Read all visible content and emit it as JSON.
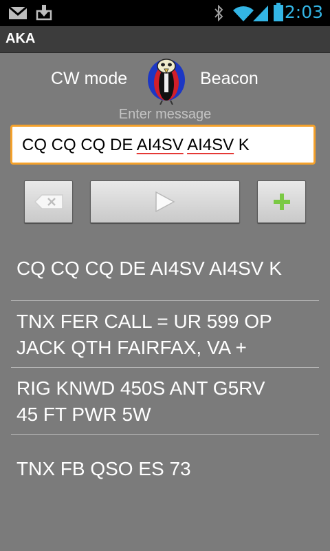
{
  "status_bar": {
    "time": "2:03",
    "icons": [
      "gmail-icon",
      "download-icon",
      "bluetooth-icon",
      "wifi-icon",
      "signal-icon",
      "battery-icon"
    ]
  },
  "app": {
    "title": "AKA"
  },
  "header": {
    "left_label": "CW mode",
    "right_label": "Beacon",
    "logo": "bird-mascot-logo"
  },
  "message": {
    "hint": "Enter message",
    "parts": [
      {
        "text": "CQ CQ CQ DE "
      },
      {
        "text": "AI4SV"
      },
      {
        "text": " "
      },
      {
        "text": "AI4SV"
      },
      {
        "text": " K"
      }
    ]
  },
  "buttons": {
    "clear": "backspace-icon",
    "play": "play-icon",
    "add": "plus-icon"
  },
  "colors": {
    "background": "#7b7b7b",
    "accent_orange": "#f4a12b",
    "clock_blue": "#33b5e5",
    "plus_green": "#7ac943"
  },
  "saved_messages": [
    {
      "line1": "CQ CQ CQ DE AI4SV AI4SV K",
      "line2": ""
    },
    {
      "line1": "TNX FER CALL = UR 599 OP",
      "line2": "JACK QTH FAIRFAX, VA +"
    },
    {
      "line1": "RIG KNWD 450S ANT G5RV",
      "line2": "45 FT PWR 5W"
    },
    {
      "line1": "TNX FB QSO ES 73",
      "line2": ""
    }
  ]
}
